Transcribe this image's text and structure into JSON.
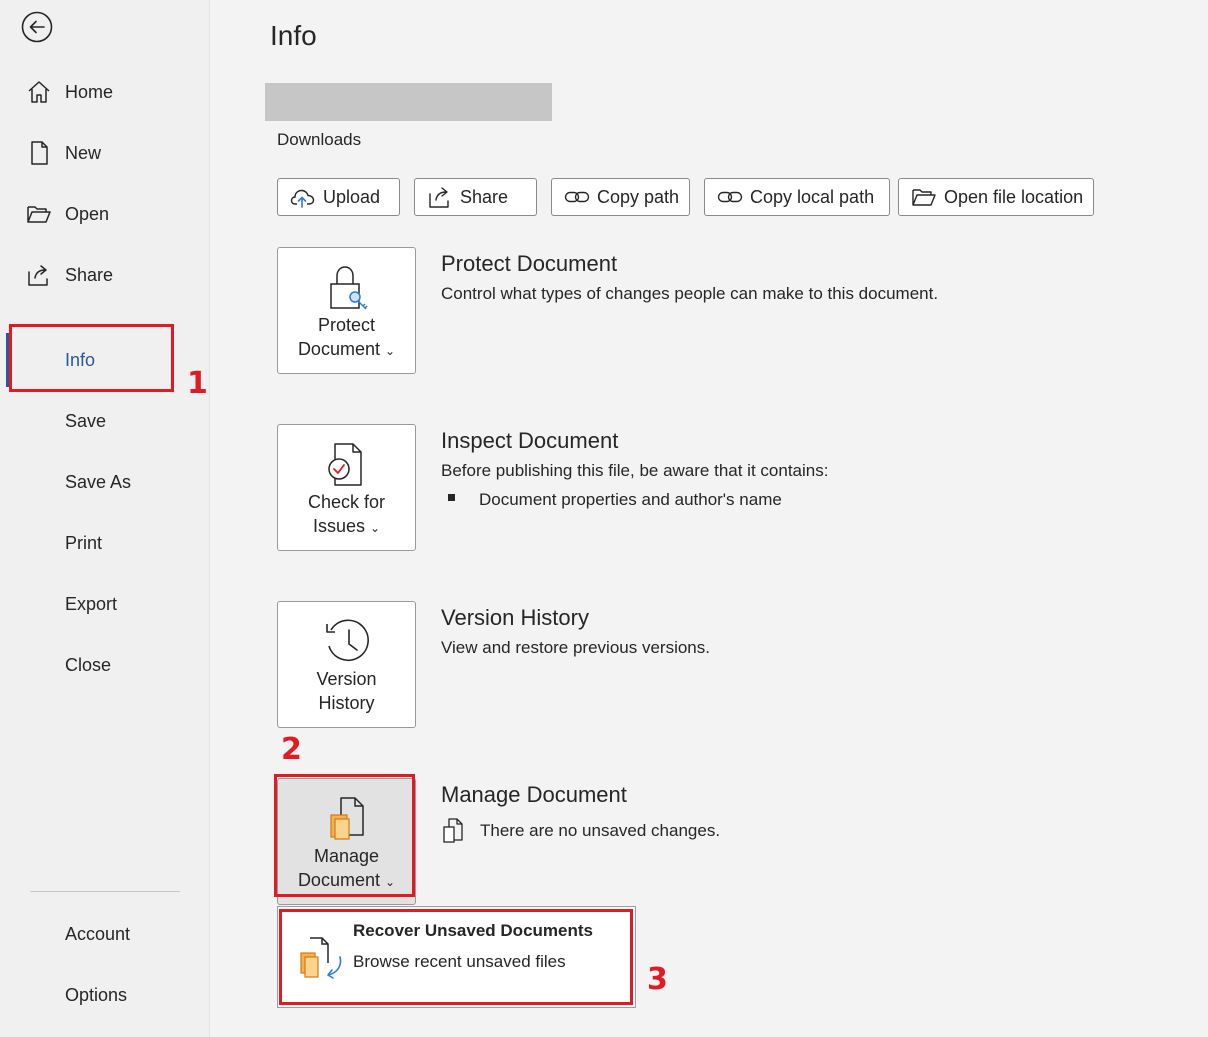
{
  "sidebar": {
    "back_icon": "back-arrow-icon",
    "items": [
      {
        "label": "Home",
        "icon": "home-icon"
      },
      {
        "label": "New",
        "icon": "new-document-icon"
      },
      {
        "label": "Open",
        "icon": "folder-open-icon"
      },
      {
        "label": "Share",
        "icon": "share-icon"
      },
      {
        "label": "Info"
      },
      {
        "label": "Save"
      },
      {
        "label": "Save As"
      },
      {
        "label": "Print"
      },
      {
        "label": "Export"
      },
      {
        "label": "Close"
      }
    ],
    "bottom_items": [
      {
        "label": "Account"
      },
      {
        "label": "Options"
      }
    ],
    "active": "Info"
  },
  "main": {
    "title": "Info",
    "path": "Downloads",
    "actions": [
      {
        "label": "Upload",
        "icon": "cloud-upload-icon"
      },
      {
        "label": "Share",
        "icon": "share-icon"
      },
      {
        "label": "Copy path",
        "icon": "link-icon"
      },
      {
        "label": "Copy local path",
        "icon": "link-icon"
      },
      {
        "label": "Open file location",
        "icon": "folder-open-icon"
      }
    ],
    "sections": [
      {
        "tile_line1": "Protect",
        "tile_line2": "Document",
        "icon": "lock-key-icon",
        "title": "Protect Document",
        "desc": "Control what types of changes people can make to this document."
      },
      {
        "tile_line1": "Check for",
        "tile_line2": "Issues",
        "icon": "inspect-document-icon",
        "title": "Inspect Document",
        "desc": "Before publishing this file, be aware that it contains:",
        "bullets": [
          "Document properties and author's name"
        ]
      },
      {
        "tile_line1": "Version",
        "tile_line2": "History",
        "icon": "history-clock-icon",
        "title": "Version History",
        "desc": "View and restore previous versions."
      },
      {
        "tile_line1": "Manage",
        "tile_line2": "Document",
        "icon": "manage-document-icon",
        "title": "Manage Document",
        "desc": "There are no unsaved changes."
      }
    ],
    "dropdown": {
      "title": "Recover Unsaved Documents",
      "subtitle": "Browse recent unsaved files",
      "icon": "recover-document-icon"
    }
  },
  "annotations": {
    "step1": "1",
    "step2": "2",
    "step3": "3",
    "color": "#e11b22"
  }
}
